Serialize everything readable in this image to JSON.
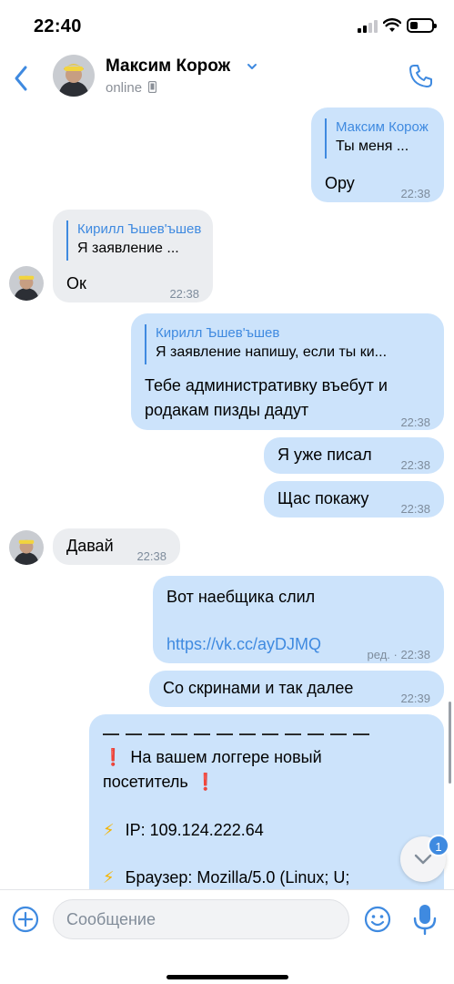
{
  "status_bar": {
    "time": "22:40",
    "battery_level": 0.35
  },
  "header": {
    "contact_name": "Максим Корож",
    "status": "online",
    "accent_color": "#3f8ae0",
    "icons": [
      "back-chevron-icon",
      "chevron-down-icon",
      "mobile-device-icon",
      "phone-icon"
    ]
  },
  "messages": [
    {
      "direction": "out",
      "reply_to": {
        "name": "Максим Корож",
        "text": "Ты меня ..."
      },
      "text": "Ору",
      "time": "22:38"
    },
    {
      "direction": "in",
      "reply_to": {
        "name": "Кирилл Ъшев'ъшев",
        "text": "Я заявление ..."
      },
      "text": "Ок",
      "time": "22:38"
    },
    {
      "direction": "out",
      "reply_to": {
        "name": "Кирилл Ъшев'ъшев",
        "text": "Я заявление напишу, если ты ки..."
      },
      "text_lines": [
        "Тебе административку въебут и",
        "родакам пизды дадут"
      ],
      "time": "22:38"
    },
    {
      "direction": "out",
      "text": "Я уже писал",
      "time": "22:38"
    },
    {
      "direction": "out",
      "text": "Щас покажу",
      "time": "22:38"
    },
    {
      "direction": "in",
      "text": "Давай",
      "time": "22:38"
    },
    {
      "direction": "out",
      "text": "Вот наебщика слил",
      "link": "https://vk.cc/ayDJMQ",
      "edited": "ред.",
      "time": "22:38"
    },
    {
      "direction": "out",
      "text": "Со скринами и так далее",
      "time": "22:39"
    },
    {
      "direction": "out",
      "dashes": "— — — — — — — — — — — —",
      "alert_icon": "❗",
      "alert_lines": [
        "На вашем логгере новый",
        "посетитель"
      ],
      "ip_icon": "⚡",
      "ip_line": "IP:  109.124.222.64",
      "browser_icon": "⚡",
      "browser_line": "Браузер: Mozilla/5.0 (Linux; U;"
    }
  ],
  "scroll_down": {
    "unread_count": "1"
  },
  "composer": {
    "placeholder": "Сообщение"
  }
}
